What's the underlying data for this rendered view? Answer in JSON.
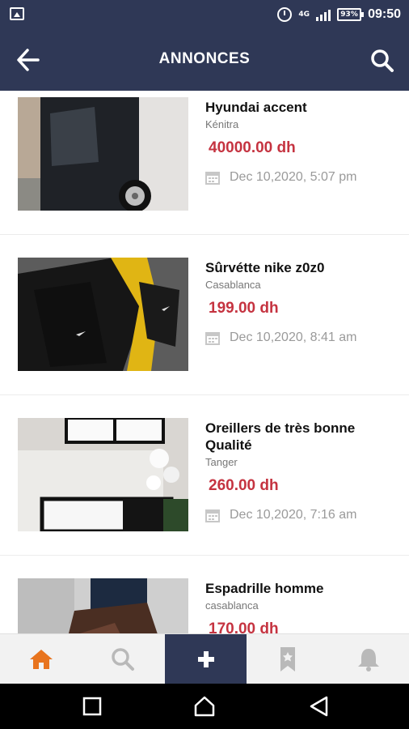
{
  "status_bar": {
    "time": "09:50",
    "battery": "93%",
    "network": "4G"
  },
  "header": {
    "title": "ANNONCES"
  },
  "listings": [
    {
      "title": "Hyundai accent",
      "city": "Kénitra",
      "price": "40000.00 dh",
      "date": "Dec 10,2020, 5:07 pm"
    },
    {
      "title": "Sûrvétte nike z0z0",
      "city": "Casablanca",
      "price": "199.00 dh",
      "date": "Dec 10,2020, 8:41 am"
    },
    {
      "title": "Oreillers de très bonne Qualité",
      "city": "Tanger",
      "price": "260.00 dh",
      "date": "Dec 10,2020, 7:16 am"
    },
    {
      "title": "Espadrille homme",
      "city": "casablanca",
      "price": "170.00 dh",
      "date": ""
    }
  ],
  "colors": {
    "header_bg": "#2f3856",
    "price": "#c53340",
    "nav_active": "#e8741e",
    "nav_inactive": "#b9b9b9"
  },
  "bottom_nav": [
    "home-icon",
    "search-icon",
    "plus-icon",
    "bookmark-icon",
    "bell-icon"
  ]
}
